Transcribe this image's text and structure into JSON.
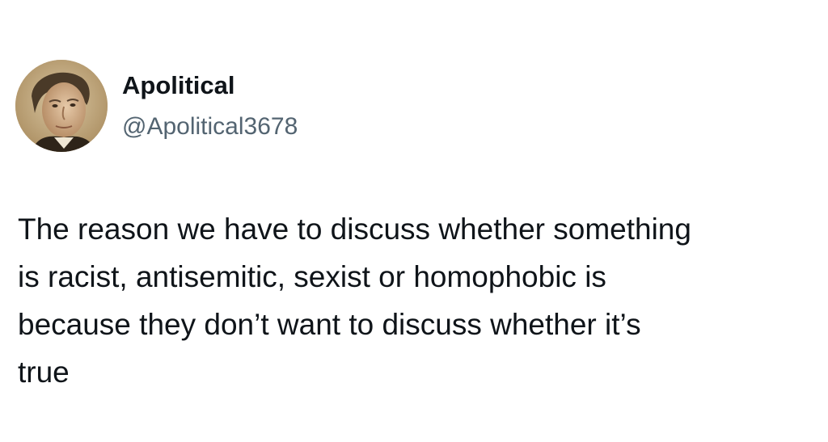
{
  "author": {
    "display_name": "Apolitical",
    "handle": "@Apolitical3678",
    "avatar_icon": "portrait-avatar-icon"
  },
  "tweet": {
    "text_lines": [
      "The reason we have to discuss whether something",
      "is racist, antisemitic, sexist or homophobic is",
      "because they don’t want to discuss whether it’s",
      "true"
    ]
  },
  "colors": {
    "background": "#ffffff",
    "text_primary": "#0f1419",
    "text_secondary": "#536471"
  }
}
